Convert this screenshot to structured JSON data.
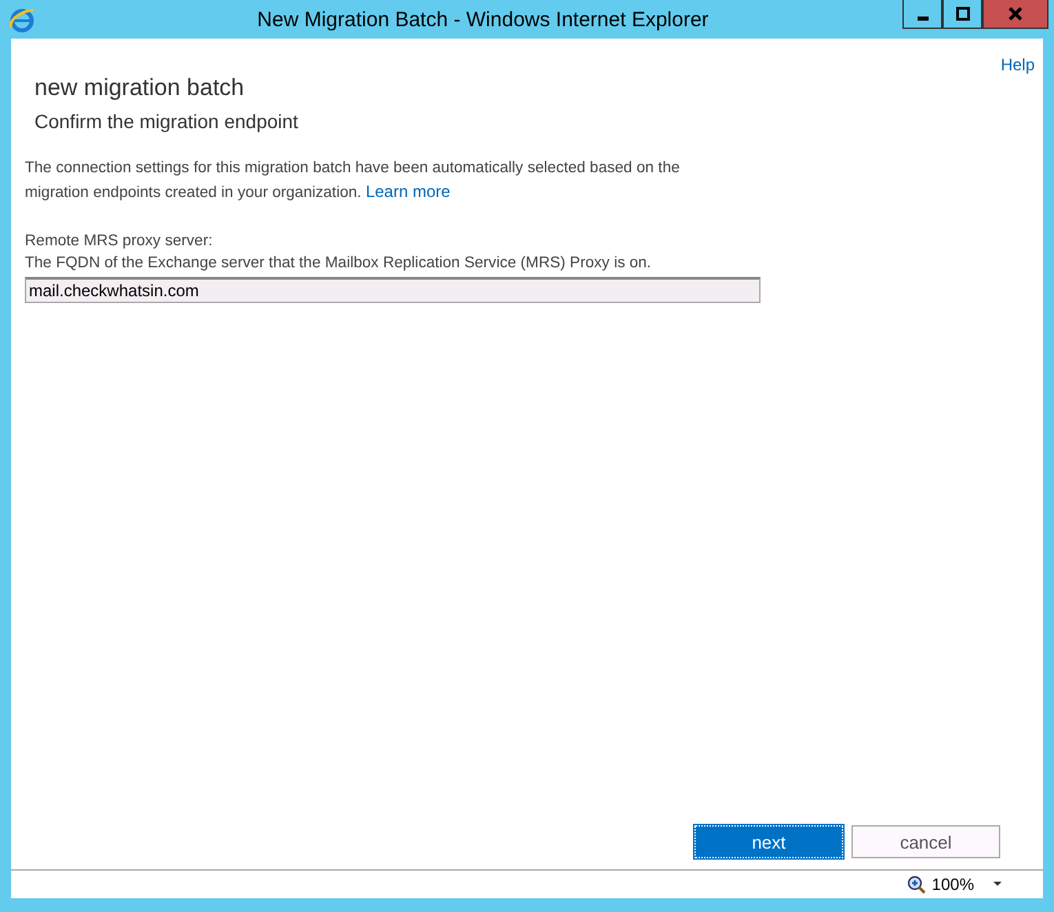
{
  "window": {
    "title": "New Migration Batch - Windows Internet Explorer"
  },
  "help_link": "Help",
  "heading": "new migration batch",
  "subheading": "Confirm the migration endpoint",
  "description": "The connection settings for this migration batch have been automatically selected based on the migration endpoints created in your organization.",
  "learn_more": "Learn more",
  "field": {
    "label": "Remote MRS proxy server:",
    "hint": "The FQDN of the Exchange server that the Mailbox Replication Service (MRS) Proxy is on.",
    "value": "mail.checkwhatsin.com"
  },
  "buttons": [
    {
      "label": "next",
      "kind": "primary"
    },
    {
      "label": "cancel",
      "kind": "secondary"
    }
  ],
  "status_bar": {
    "zoom": "100%"
  }
}
